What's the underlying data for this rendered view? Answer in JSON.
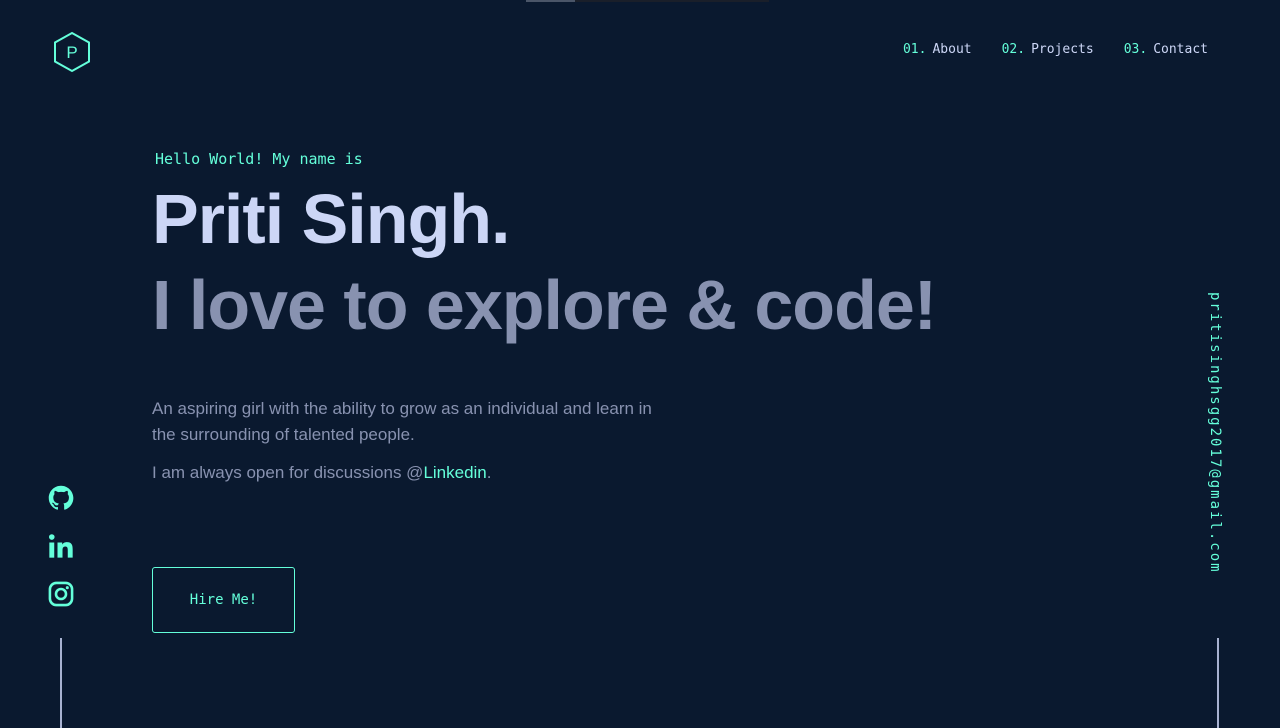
{
  "brand": {
    "logo_letter": "P"
  },
  "nav": [
    {
      "num": "01.",
      "label": "About"
    },
    {
      "num": "02.",
      "label": "Projects"
    },
    {
      "num": "03.",
      "label": "Contact"
    }
  ],
  "hero": {
    "greeting": "Hello World! My name is",
    "name": "Priti Singh.",
    "tagline": "I love to explore & code!",
    "about": "An aspiring girl with the ability to grow as an individual and learn in the surrounding of talented people.",
    "open_prefix": "I am always open for discussions @",
    "open_link": "Linkedin",
    "open_suffix": ".",
    "cta": "Hire Me!"
  },
  "social": [
    "github-icon",
    "linkedin-icon",
    "instagram-icon"
  ],
  "email": "pritisinghsgg2017@gmail.com",
  "colors": {
    "background": "#0a192f",
    "accent": "#64ffda",
    "heading": "#ccd6f6",
    "muted": "#8892b0"
  }
}
